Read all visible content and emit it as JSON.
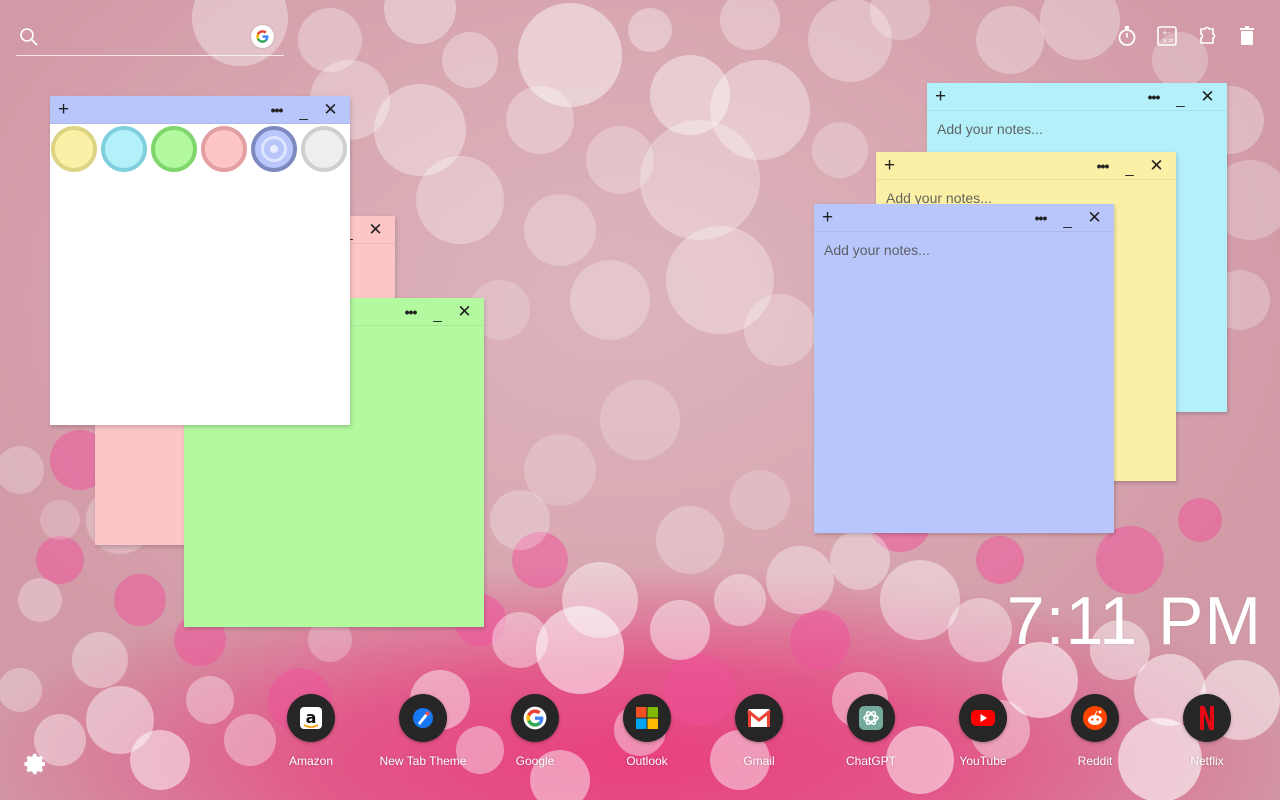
{
  "search": {
    "placeholder": ""
  },
  "top_tools": [
    {
      "name": "timer-icon"
    },
    {
      "name": "calculator-icon"
    },
    {
      "name": "puzzle-extension-icon"
    },
    {
      "name": "trash-icon"
    }
  ],
  "notes": [
    {
      "id": "cyan",
      "color": "#b3f0fa",
      "placeholder": "Add your notes..."
    },
    {
      "id": "yellow",
      "color": "#fbf0a5",
      "placeholder": "Add your notes..."
    },
    {
      "id": "blue",
      "color": "#b8c6fc",
      "placeholder": "Add your notes..."
    },
    {
      "id": "pink",
      "color": "#fec5c6",
      "placeholder": ""
    },
    {
      "id": "green",
      "color": "#b2f99f",
      "placeholder": ""
    },
    {
      "id": "white",
      "color": "#ffffff",
      "placeholder": ""
    }
  ],
  "note_controls": {
    "add": "+",
    "more": "•••",
    "minimize": "_",
    "close": "✕"
  },
  "color_swatches": [
    {
      "name": "yellow",
      "fill": "#fbf0a5",
      "border": "#dcd483"
    },
    {
      "name": "cyan",
      "fill": "#b3f0fa",
      "border": "#7fcfdc"
    },
    {
      "name": "green",
      "fill": "#b2f99f",
      "border": "#7fd66c"
    },
    {
      "name": "pink",
      "fill": "#fec5c6",
      "border": "#e29ea0"
    },
    {
      "name": "blue",
      "fill": "#b8c6fc",
      "border": "#7c8ac0"
    },
    {
      "name": "white",
      "fill": "#eeeeee",
      "border": "#cfcfcf"
    }
  ],
  "clock": {
    "time": "7:11 PM"
  },
  "dock": [
    {
      "label": "Amazon",
      "icon": "amazon-icon"
    },
    {
      "label": "New Tab Theme",
      "icon": "new-tab-theme-icon"
    },
    {
      "label": "Google",
      "icon": "google-icon"
    },
    {
      "label": "Outlook",
      "icon": "outlook-icon"
    },
    {
      "label": "Gmail",
      "icon": "gmail-icon"
    },
    {
      "label": "ChatGPT",
      "icon": "chatgpt-icon"
    },
    {
      "label": "YouTube",
      "icon": "youtube-icon"
    },
    {
      "label": "Reddit",
      "icon": "reddit-icon"
    },
    {
      "label": "Netflix",
      "icon": "netflix-icon"
    }
  ]
}
